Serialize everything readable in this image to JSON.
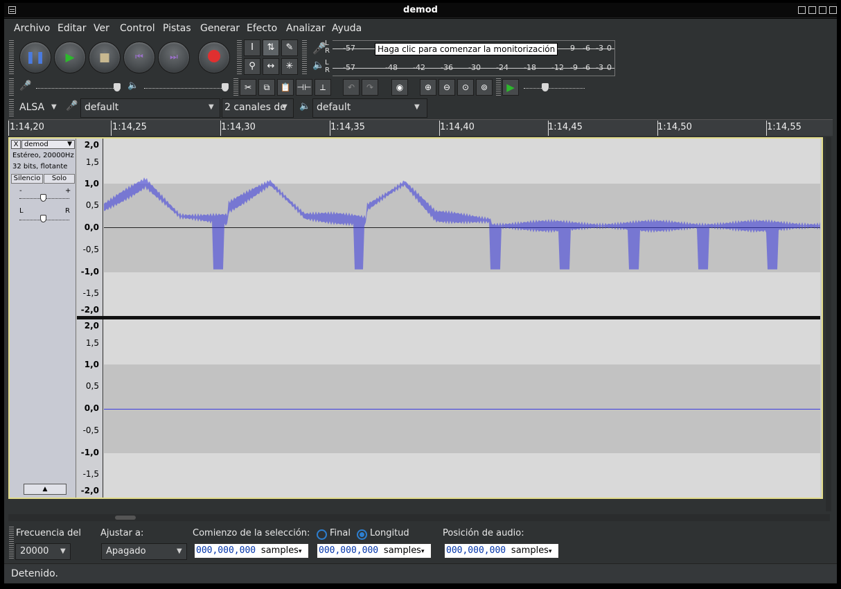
{
  "window": {
    "title": "demod"
  },
  "menu": [
    "Archivo",
    "Editar",
    "Ver",
    "Control",
    "Pistas",
    "Generar",
    "Efecto",
    "Analizar",
    "Ayuda"
  ],
  "meter": {
    "rec_scale": "-57",
    "play_scale": [
      "-57",
      "-48",
      "-42",
      "-36",
      "-30",
      "-24",
      "-18",
      "-12",
      "-9",
      "-6",
      "-3",
      "0"
    ],
    "rec_right": [
      "9",
      "-6",
      "-3",
      "0"
    ],
    "lr_labels": [
      "L",
      "R",
      "L",
      "R"
    ],
    "tooltip": "Haga clic para comenzar la monitorización"
  },
  "devices": {
    "host": "ALSA",
    "rec_device": "default",
    "channels": "2 canales de",
    "play_device": "default"
  },
  "ruler": {
    "labels": [
      "1:14,20",
      "1:14,25",
      "1:14,30",
      "1:14,35",
      "1:14,40",
      "1:14,45",
      "1:14,50",
      "1:14,55"
    ]
  },
  "track": {
    "name": "demod",
    "format": "Estéreo, 20000Hz",
    "bits": "32 bits, flotante",
    "mute": "Silencio",
    "solo": "Solo",
    "gain_minus": "-",
    "gain_plus": "+",
    "pan_left": "L",
    "pan_right": "R",
    "collapse": "▲",
    "close": "X",
    "menu_arrow": "▼"
  },
  "vruler": [
    "2,0",
    "1,5",
    "1,0",
    "0,5",
    "0,0",
    "-0,5",
    "-1,0",
    "-1,5",
    "-2,0"
  ],
  "selection_bar": {
    "rate_label": "Frecuencia del",
    "rate_value": "20000",
    "snap_label": "Ajustar a:",
    "snap_value": "Apagado",
    "start_label": "Comienzo de la selección:",
    "end_label": "Final",
    "length_label": "Longitud",
    "audio_pos_label": "Posición de audio:",
    "start_value": "000,000,000",
    "end_value": "000,000,000",
    "audio_value": "000,000,000",
    "unit": "samples"
  },
  "status": "Detenido.",
  "colors": {
    "waveform": "#3a3ae0",
    "selection_border": "#e2dc8a",
    "record_red": "#e03030",
    "play_green": "#2db82d"
  }
}
